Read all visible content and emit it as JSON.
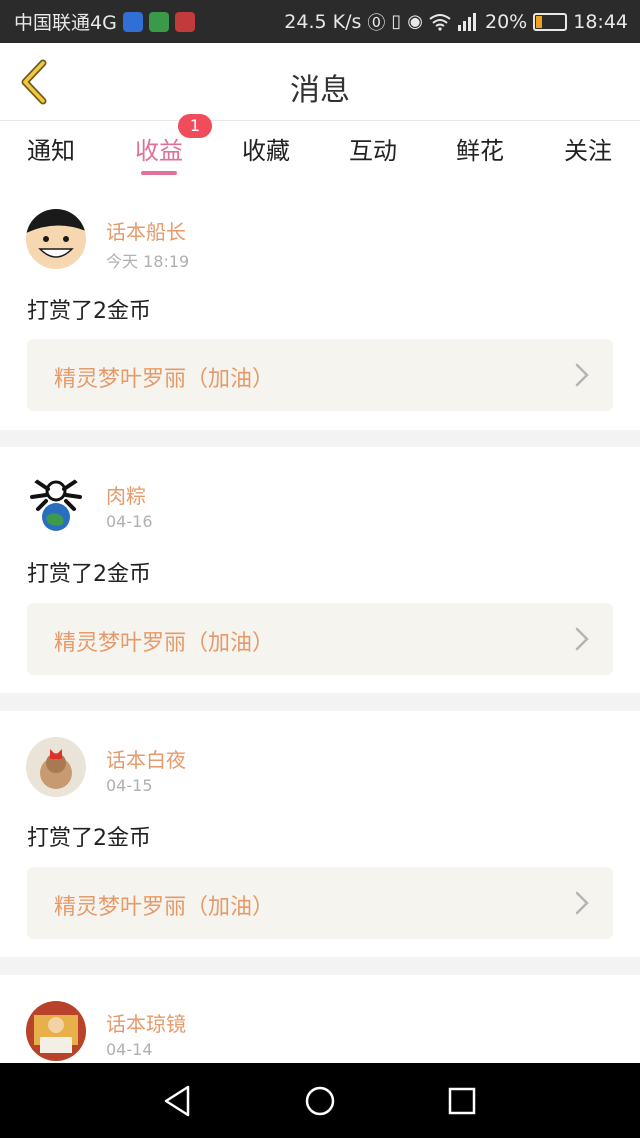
{
  "status_bar": {
    "carrier": "中国联通4G",
    "net_speed": "24.5 K/s",
    "battery_level": "20%",
    "battery_fraction": 0.2,
    "time": "18:44",
    "icons": [
      "shield-app-icon",
      "green-app-icon",
      "red-app-icon",
      "nfc-icon",
      "vibrate-icon",
      "eye-icon",
      "wifi-icon",
      "signal-icon",
      "battery-icon"
    ]
  },
  "header": {
    "title": "消息",
    "back_icon": "chevron-left-icon"
  },
  "tabs": [
    {
      "label": "通知"
    },
    {
      "label": "收益",
      "active": true,
      "badge": "1"
    },
    {
      "label": "收藏"
    },
    {
      "label": "互动"
    },
    {
      "label": "鲜花"
    },
    {
      "label": "关注"
    }
  ],
  "messages": [
    {
      "user": "话本船长",
      "time": "今天 18:19",
      "text": "打赏了2金币",
      "work": "精灵梦叶罗丽（加油）"
    },
    {
      "user": "肉粽",
      "time": "04-16",
      "text": "打赏了2金币",
      "work": "精灵梦叶罗丽（加油）"
    },
    {
      "user": "话本白夜",
      "time": "04-15",
      "text": "打赏了2金币",
      "work": "精灵梦叶罗丽（加油）"
    },
    {
      "user": "话本琼镜",
      "time": "04-14"
    }
  ],
  "nav": {
    "icons": [
      "back-triangle-icon",
      "home-circle-icon",
      "recents-square-icon"
    ]
  },
  "colors": {
    "accent": "#e0709a",
    "username": "#e69a6a",
    "badge": "#f04c5c"
  }
}
